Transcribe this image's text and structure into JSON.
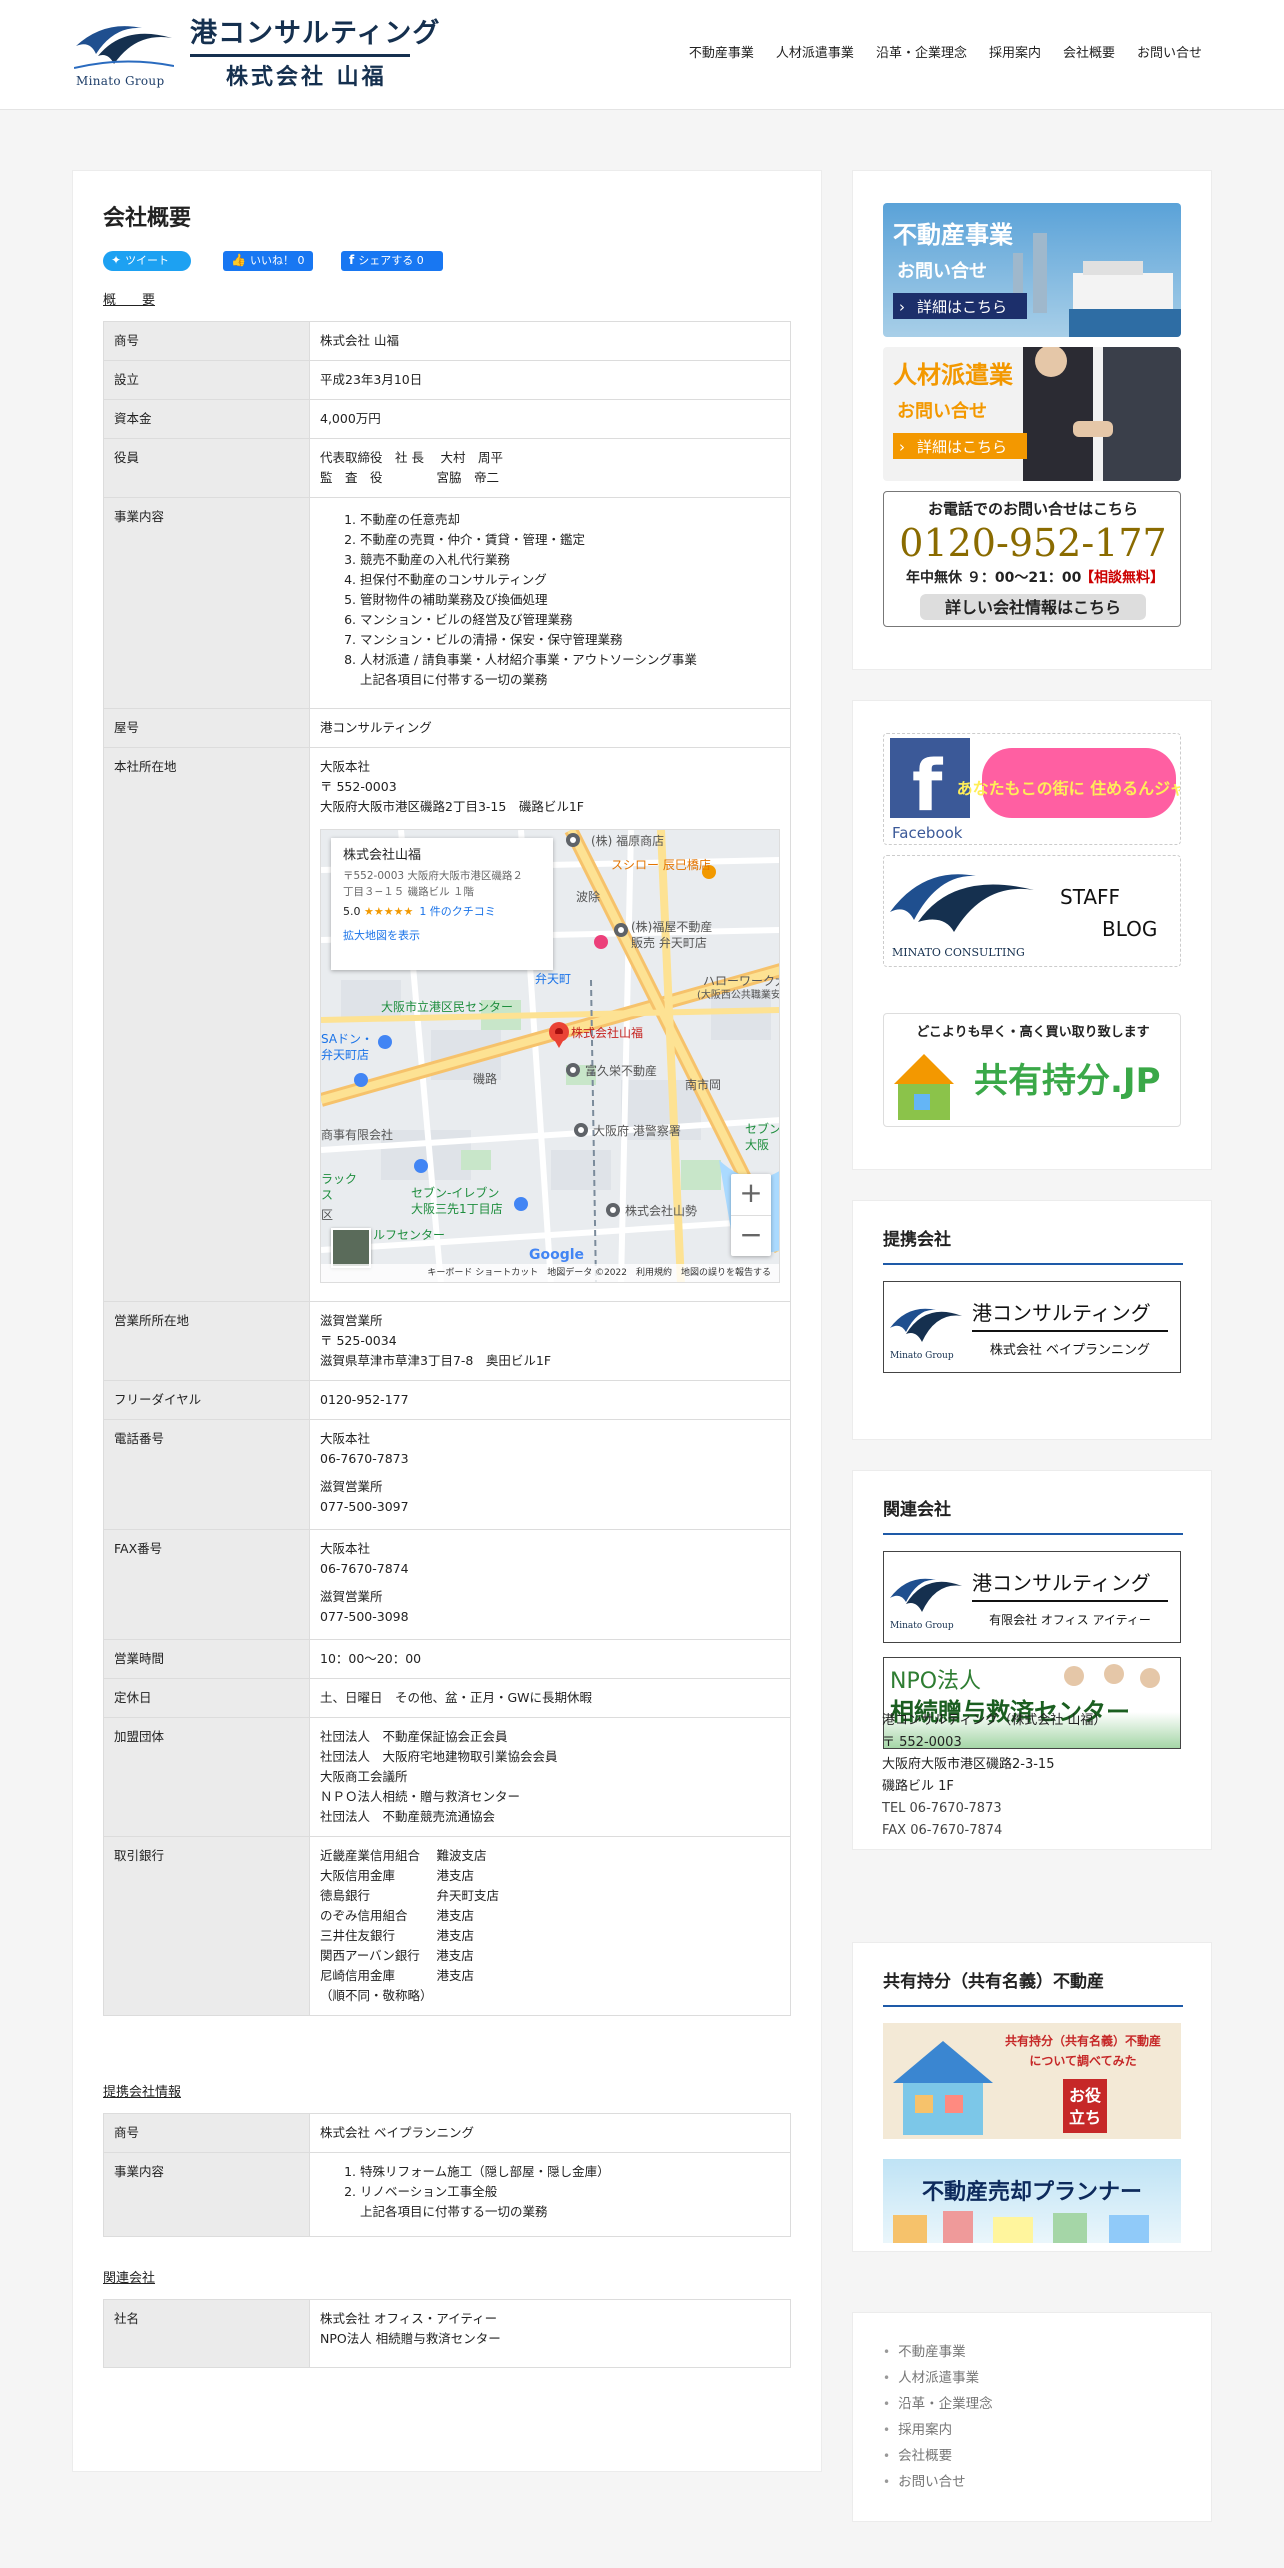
{
  "header": {
    "logo_group": "Minato Group",
    "logo_title": "港コンサルティング",
    "logo_company": "株式会社 山福",
    "nav": [
      "不動産事業",
      "人材派遣事業",
      "沿革・企業理念",
      "採用案内",
      "会社概要",
      "お問い合せ"
    ]
  },
  "main": {
    "title": "会社概要",
    "share": {
      "tweet": "ツイート",
      "like": "いいね！ 0",
      "fbshare": "シェアする 0"
    },
    "section1": "概　　要",
    "overview": {
      "shogo": {
        "k": "商号",
        "v": "株式会社 山福"
      },
      "setsuritsu": {
        "k": "設立",
        "v": "平成23年3月10日"
      },
      "shihon": {
        "k": "資本金",
        "v": "4,000万円"
      },
      "yakuin": {
        "k": "役員",
        "v": [
          "代表取締役　社 長　 大村　周平",
          "監　査　役　　　　 宮脇　帝二"
        ]
      },
      "jigyo": {
        "k": "事業内容",
        "items": [
          "不動産の任意売却",
          "不動産の売買・仲介・賃貸・管理・鑑定",
          "競売不動産の入札代行業務",
          "担保付不動産のコンサルティング",
          "管財物件の補助業務及び換価処理",
          "マンション・ビルの経営及び管理業務",
          "マンション・ビルの清掃・保安・保守管理業務",
          "人材派遣 / 請負事業・人材紹介事業・アウトソーシング事業"
        ],
        "note": "上記各項目に付帯する一切の業務"
      },
      "yago": {
        "k": "屋号",
        "v": "港コンサルティング"
      },
      "honsha": {
        "k": "本社所在地",
        "v": [
          "大阪本社",
          "〒 552-0003",
          "大阪府大阪市港区磯路2丁目3-15　磯路ビル1F"
        ]
      },
      "map": {
        "name": "株式会社山福",
        "addr1": "〒552-0003 大阪府大阪市港区磯路２",
        "addr2": "丁目３−１５ 磯路ビル １階",
        "rating": "5.0",
        "stars": "★★★★★",
        "reviews": "1 件のクチコミ",
        "enlarge": "拡大地図を表示",
        "marker": "株式会社山福",
        "labels": [
          "(株) 福原商店",
          "スシロー 辰巳橋店",
          "波除",
          "(株)福屋不動産",
          "販売 弁天町店",
          "ハローワーク大阪西",
          "(大阪西公共職業安定所)",
          "弁天町",
          "大阪市立港区民センター",
          "SAドン・",
          "弁天町店",
          "磯路",
          "富久栄不動産",
          "南市岡",
          "大阪府 港警察署",
          "商事有限会社",
          "株式会社山勢",
          "セブン-イレブン",
          "大阪三先1丁目店",
          "ルフセンター",
          "区",
          "ラック",
          "ス",
          "セブン",
          "大阪"
        ],
        "zoom_in": "+",
        "zoom_out": "−",
        "google": "Google",
        "footer": "キーボード ショートカット　地図データ ©2022　利用規約　地図の誤りを報告する"
      },
      "eigyosho": {
        "k": "営業所所在地",
        "v": [
          "滋賀営業所",
          "〒 525-0034",
          "滋賀県草津市草津3丁目7-8　奥田ビル1F"
        ]
      },
      "free": {
        "k": "フリーダイヤル",
        "v": "0120-952-177"
      },
      "tel": {
        "k": "電話番号",
        "v1": [
          "大阪本社",
          "06-7670-7873"
        ],
        "v2": [
          "滋賀営業所",
          "077-500-3097"
        ]
      },
      "fax": {
        "k": "FAX番号",
        "v1": [
          "大阪本社",
          "06-7670-7874"
        ],
        "v2": [
          "滋賀営業所",
          "077-500-3098"
        ]
      },
      "hours": {
        "k": "営業時間",
        "v": "10：00～20：00"
      },
      "holiday": {
        "k": "定休日",
        "v": "土、日曜日　その他、盆・正月・GWに長期休暇"
      },
      "dantai": {
        "k": "加盟団体",
        "v": [
          "社団法人　不動産保証協会正会員",
          "社団法人　大阪府宅地建物取引業協会会員",
          "大阪商工会議所",
          "ＮＰＯ法人相続・贈与救済センター",
          "社団法人　不動産競売流通協会"
        ]
      },
      "bank": {
        "k": "取引銀行",
        "v": [
          "近畿産業信用組合　 難波支店",
          "大阪信用金庫　　　 港支店",
          "徳島銀行　　　　　 弁天町支店",
          "のぞみ信用組合　　 港支店",
          "三井住友銀行　　　 港支店",
          "関西アーバン銀行　 港支店",
          "尼崎信用金庫　　　 港支店",
          "（順不同・敬称略）"
        ]
      }
    },
    "section2": "提携会社情報",
    "partner": {
      "shogo": {
        "k": "商号",
        "v": "株式会社 ベイプランニング"
      },
      "jigyo": {
        "k": "事業内容",
        "items": [
          "特殊リフォーム施工（隠し部屋・隠し金庫）",
          "リノベーション工事全般"
        ],
        "note": "上記各項目に付帯する一切の業務"
      }
    },
    "section3": "関連会社",
    "related": {
      "name": {
        "k": "社名",
        "v": [
          "株式会社 オフィス・アイティー",
          "NPO法人 相続贈与救済センター"
        ]
      }
    }
  },
  "sidebar": {
    "banners1": {
      "fudosan": {
        "t1": "不動産事業",
        "t2": "お問い合せ",
        "btn": "詳細はこちら"
      },
      "jinzai": {
        "t1": "人材派遣業",
        "t2": "お問い合せ",
        "btn": "詳細はこちら"
      },
      "phone": {
        "t1": "お電話でのお問い合せはこちら",
        "num": "0120-952-177",
        "t2": "年中無休 ９：00～21：00",
        "t3": "【相談無料】",
        "btn": "詳しい会社情報はこちら"
      }
    },
    "banners2": {
      "facebook": "Facebook",
      "sumeru": "あなたもこの街に 住めるんジャー",
      "staff1": "STAFF",
      "staff2": "BLOG",
      "mc": "MINATO CONSULTING",
      "kyoyu1": "どこよりも早く・高く買い取り致します",
      "kyoyu2": "共有持分.JP"
    },
    "teikei": {
      "title": "提携会社",
      "logo": "港コンサルティング",
      "sub": "株式会社 ベイプランニング",
      "group": "Minato Group"
    },
    "kanren": {
      "title": "関連会社",
      "logo": "港コンサルティング",
      "sub": "有限会社 オフィス アイティー",
      "group": "Minato Group",
      "npo1": "NPO法人",
      "npo2": "相続贈与救済センター"
    },
    "address": [
      "港コンサルティング（株式会社 山福）",
      "〒 552-0003",
      "大阪府大阪市港区磯路2-3-15",
      "磯路ビル 1F",
      "TEL 06-7670-7873",
      "FAX 06-7670-7874"
    ],
    "kyoyu": {
      "title": "共有持分（共有名義）不動産",
      "b1a": "共有持分（共有名義）不動産",
      "b1b": "について調べてみた",
      "b1c": "お役",
      "b1d": "立ち",
      "b2": "不動産売却プランナー"
    },
    "menu": [
      "不動産事業",
      "人材派遣事業",
      "沿革・企業理念",
      "採用案内",
      "会社概要",
      "お問い合せ"
    ]
  },
  "colors": {
    "accent": "#1e5aa8",
    "navy": "#15304f",
    "label_bg": "#ebebeb"
  }
}
